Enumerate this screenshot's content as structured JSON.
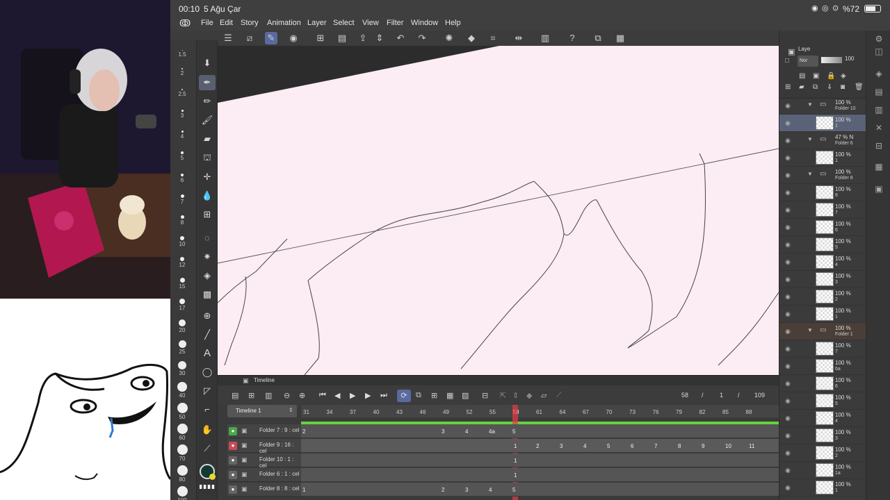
{
  "status": {
    "time": "00:10",
    "date": "5 Ağu Çar",
    "battery": "%72"
  },
  "menu": [
    "File",
    "Edit",
    "Story",
    "Animation",
    "Layer",
    "Select",
    "View",
    "Filter",
    "Window",
    "Help"
  ],
  "brush_sizes": [
    "1.5",
    "2",
    "2.5",
    "3",
    "4",
    "5",
    "6",
    "7",
    "8",
    "10",
    "12",
    "15",
    "17",
    "20",
    "25",
    "30",
    "40",
    "50",
    "60",
    "70",
    "80",
    "100"
  ],
  "layer_panel": {
    "tab": "Laye",
    "blend": "Nor",
    "opacity": "100",
    "layers": [
      {
        "op": "100 %",
        "name": "Folder 10",
        "type": "folder"
      },
      {
        "op": "100 %",
        "name": "1",
        "type": "layer",
        "selected": true
      },
      {
        "op": "47 % N",
        "name": "Folder 6",
        "type": "folder"
      },
      {
        "op": "100 %",
        "name": "1",
        "type": "layer"
      },
      {
        "op": "100 %",
        "name": "Folder 8",
        "type": "folder"
      },
      {
        "op": "100 %",
        "name": "8",
        "type": "layer"
      },
      {
        "op": "100 %",
        "name": "7",
        "type": "layer"
      },
      {
        "op": "100 %",
        "name": "6",
        "type": "layer"
      },
      {
        "op": "100 %",
        "name": "5",
        "type": "layer"
      },
      {
        "op": "100 %",
        "name": "4",
        "type": "layer"
      },
      {
        "op": "100 %",
        "name": "3",
        "type": "layer"
      },
      {
        "op": "100 %",
        "name": "2",
        "type": "layer"
      },
      {
        "op": "100 %",
        "name": "1",
        "type": "layer"
      },
      {
        "op": "100 %",
        "name": "Folder 1",
        "type": "folder"
      },
      {
        "op": "100 %",
        "name": "7",
        "type": "layer"
      },
      {
        "op": "100 %",
        "name": "6a",
        "type": "layer"
      },
      {
        "op": "100 %",
        "name": "6",
        "type": "layer"
      },
      {
        "op": "100 %",
        "name": "5",
        "type": "layer"
      },
      {
        "op": "100 %",
        "name": "4",
        "type": "layer"
      },
      {
        "op": "100 %",
        "name": "3",
        "type": "layer"
      },
      {
        "op": "100 %",
        "name": "2",
        "type": "layer"
      },
      {
        "op": "100 %",
        "name": "1a",
        "type": "layer"
      },
      {
        "op": "100 %",
        "name": "1",
        "type": "layer"
      }
    ]
  },
  "timeline": {
    "title": "Timeline",
    "name": "Timeline 1",
    "current_frame": "58",
    "page": "1",
    "total": "109",
    "frame_numbers": [
      "31",
      "34",
      "37",
      "40",
      "43",
      "46",
      "49",
      "52",
      "55",
      "58",
      "61",
      "64",
      "67",
      "70",
      "73",
      "76",
      "79",
      "82",
      "85",
      "88"
    ],
    "tracks": [
      {
        "name": "Folder 7 : 9 : cel",
        "cels": [
          "2",
          "3",
          "4",
          "4a",
          "5"
        ]
      },
      {
        "name": "Folder 9 : 16 : cel",
        "cels": [
          "1",
          "2",
          "3",
          "4",
          "5",
          "6",
          "7",
          "8",
          "9",
          "10",
          "11"
        ]
      },
      {
        "name": "Folder 10 : 1 : cel",
        "cels": [
          "1"
        ]
      },
      {
        "name": "Folder 6 : 1 : cel",
        "cels": [
          "1"
        ]
      },
      {
        "name": "Folder 8 : 8 : cel",
        "cels": [
          "1",
          "2",
          "3",
          "4",
          "5"
        ]
      }
    ]
  }
}
